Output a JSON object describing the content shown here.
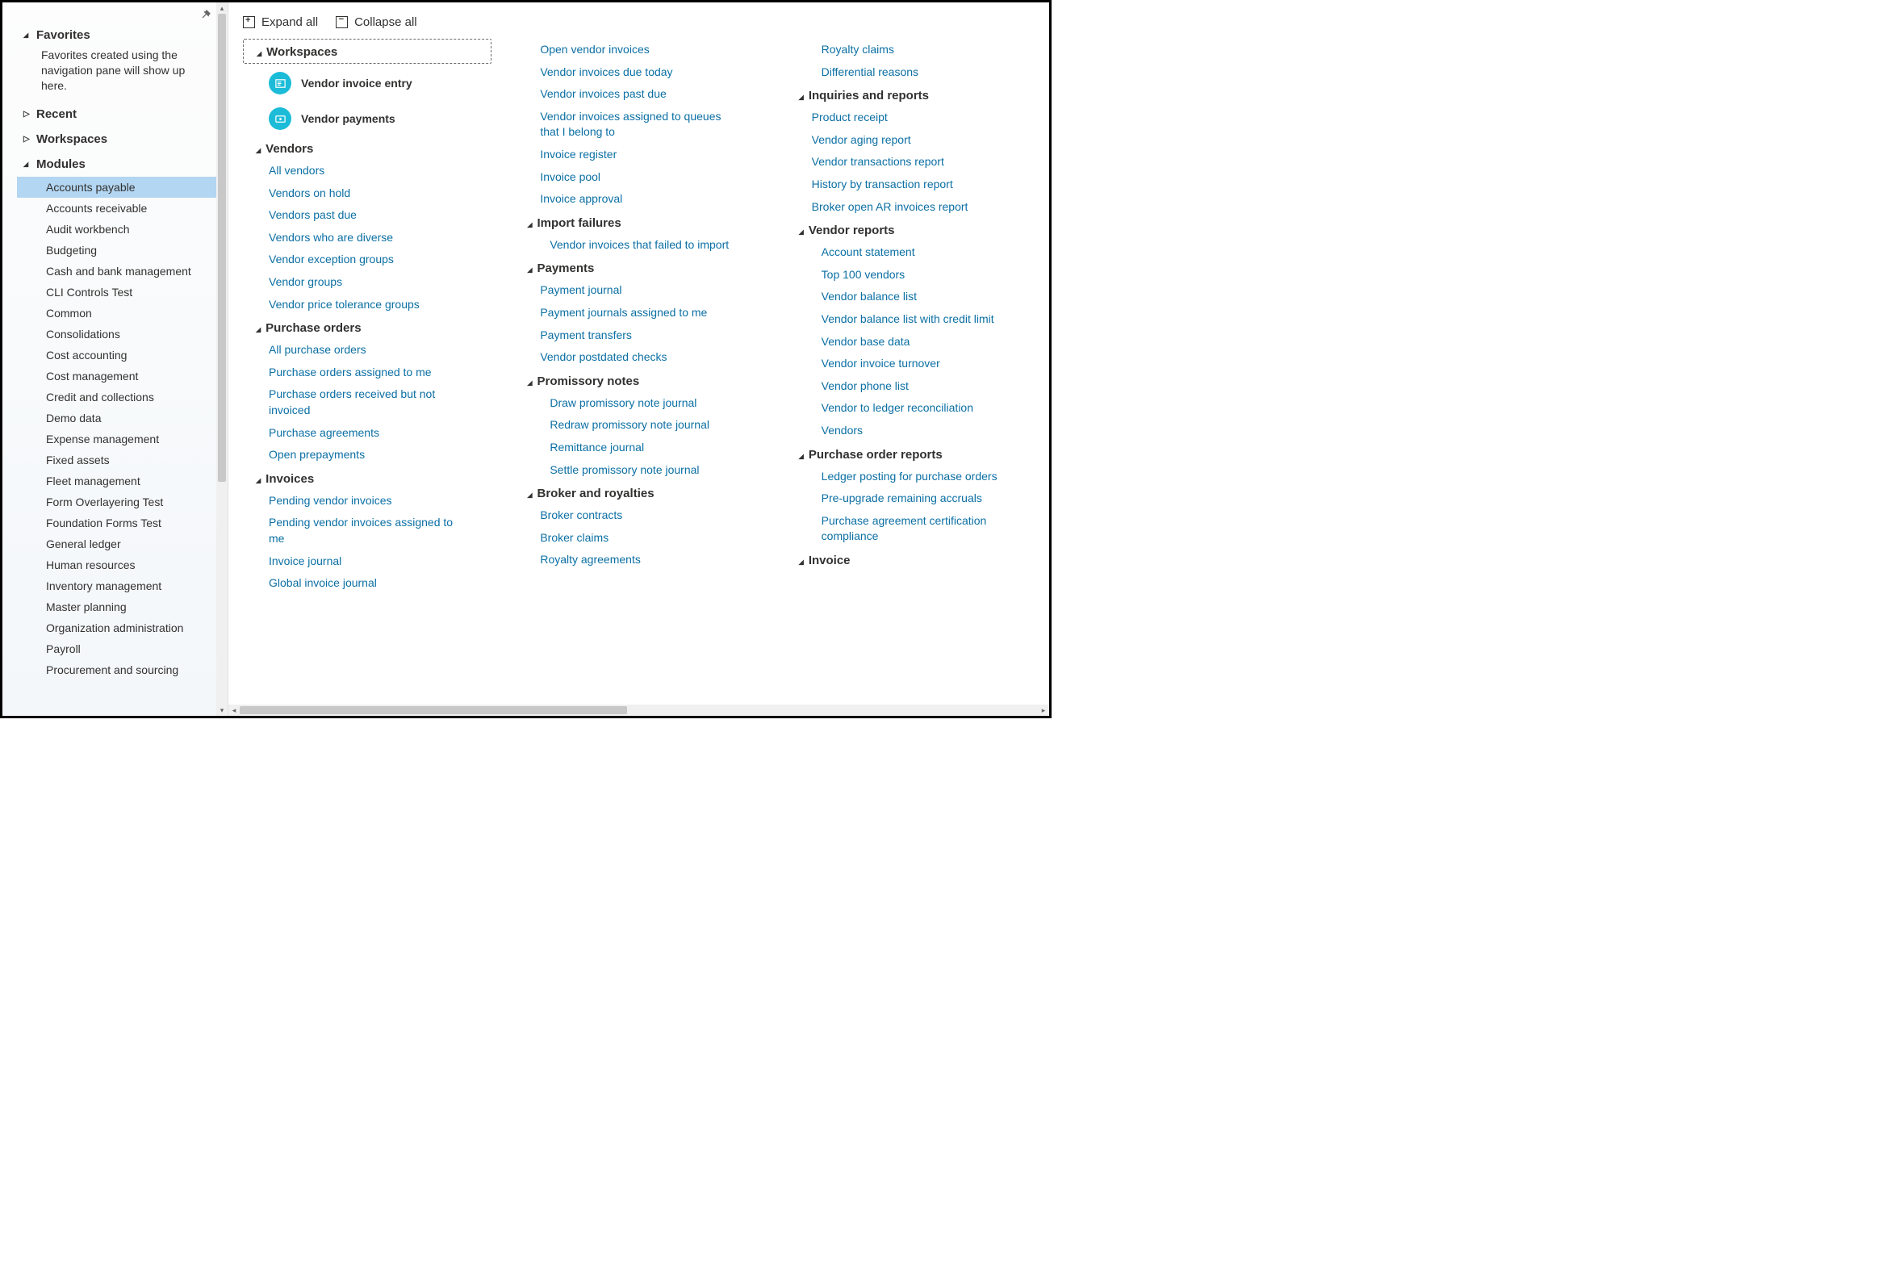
{
  "sidebar": {
    "favorites_label": "Favorites",
    "favorites_hint": "Favorites created using the navigation pane will show up here.",
    "recent_label": "Recent",
    "workspaces_label": "Workspaces",
    "modules_label": "Modules",
    "modules": [
      "Accounts payable",
      "Accounts receivable",
      "Audit workbench",
      "Budgeting",
      "Cash and bank management",
      "CLI Controls Test",
      "Common",
      "Consolidations",
      "Cost accounting",
      "Cost management",
      "Credit and collections",
      "Demo data",
      "Expense management",
      "Fixed assets",
      "Fleet management",
      "Form Overlayering Test",
      "Foundation Forms Test",
      "General ledger",
      "Human resources",
      "Inventory management",
      "Master planning",
      "Organization administration",
      "Payroll",
      "Procurement and sourcing"
    ]
  },
  "toolbar": {
    "expand_label": "Expand all",
    "collapse_label": "Collapse all"
  },
  "content": {
    "col1": {
      "g0": {
        "header": "Workspaces",
        "ws0": "Vendor invoice entry",
        "ws1": "Vendor payments"
      },
      "g1": {
        "header": "Vendors",
        "i0": "All vendors",
        "i1": "Vendors on hold",
        "i2": "Vendors past due",
        "i3": "Vendors who are diverse",
        "i4": "Vendor exception groups",
        "i5": "Vendor groups",
        "i6": "Vendor price tolerance groups"
      },
      "g2": {
        "header": "Purchase orders",
        "i0": "All purchase orders",
        "i1": "Purchase orders assigned to me",
        "i2": "Purchase orders received but not invoiced",
        "i3": "Purchase agreements",
        "i4": "Open prepayments"
      },
      "g3": {
        "header": "Invoices",
        "i0": "Pending vendor invoices",
        "i1": "Pending vendor invoices assigned to me",
        "i2": "Invoice journal",
        "i3": "Global invoice journal"
      }
    },
    "col2": {
      "top": {
        "i0": "Open vendor invoices",
        "i1": "Vendor invoices due today",
        "i2": "Vendor invoices past due",
        "i3": "Vendor invoices assigned to queues that I belong to",
        "i4": "Invoice register",
        "i5": "Invoice pool",
        "i6": "Invoice approval"
      },
      "g0": {
        "header": "Import failures",
        "i0": "Vendor invoices that failed to import"
      },
      "g1": {
        "header": "Payments",
        "i0": "Payment journal",
        "i1": "Payment journals assigned to me",
        "i2": "Payment transfers",
        "i3": "Vendor postdated checks"
      },
      "g2": {
        "header": "Promissory notes",
        "i0": "Draw promissory note journal",
        "i1": "Redraw promissory note journal",
        "i2": "Remittance journal",
        "i3": "Settle promissory note journal"
      },
      "g3": {
        "header": "Broker and royalties",
        "i0": "Broker contracts",
        "i1": "Broker claims",
        "i2": "Royalty agreements"
      }
    },
    "col3": {
      "top": {
        "i0": "Royalty claims",
        "i1": "Differential reasons"
      },
      "g0": {
        "header": "Inquiries and reports",
        "i0": "Product receipt",
        "i1": "Vendor aging report",
        "i2": "Vendor transactions report",
        "i3": "History by transaction report",
        "i4": "Broker open AR invoices report"
      },
      "g1": {
        "header": "Vendor reports",
        "i0": "Account statement",
        "i1": "Top 100 vendors",
        "i2": "Vendor balance list",
        "i3": "Vendor balance list with credit limit",
        "i4": "Vendor base data",
        "i5": "Vendor invoice turnover",
        "i6": "Vendor phone list",
        "i7": "Vendor to ledger reconciliation",
        "i8": "Vendors"
      },
      "g2": {
        "header": "Purchase order reports",
        "i0": "Ledger posting for purchase orders",
        "i1": "Pre-upgrade remaining accruals",
        "i2": "Purchase agreement certification compliance"
      },
      "g3": {
        "header": "Invoice"
      }
    }
  }
}
